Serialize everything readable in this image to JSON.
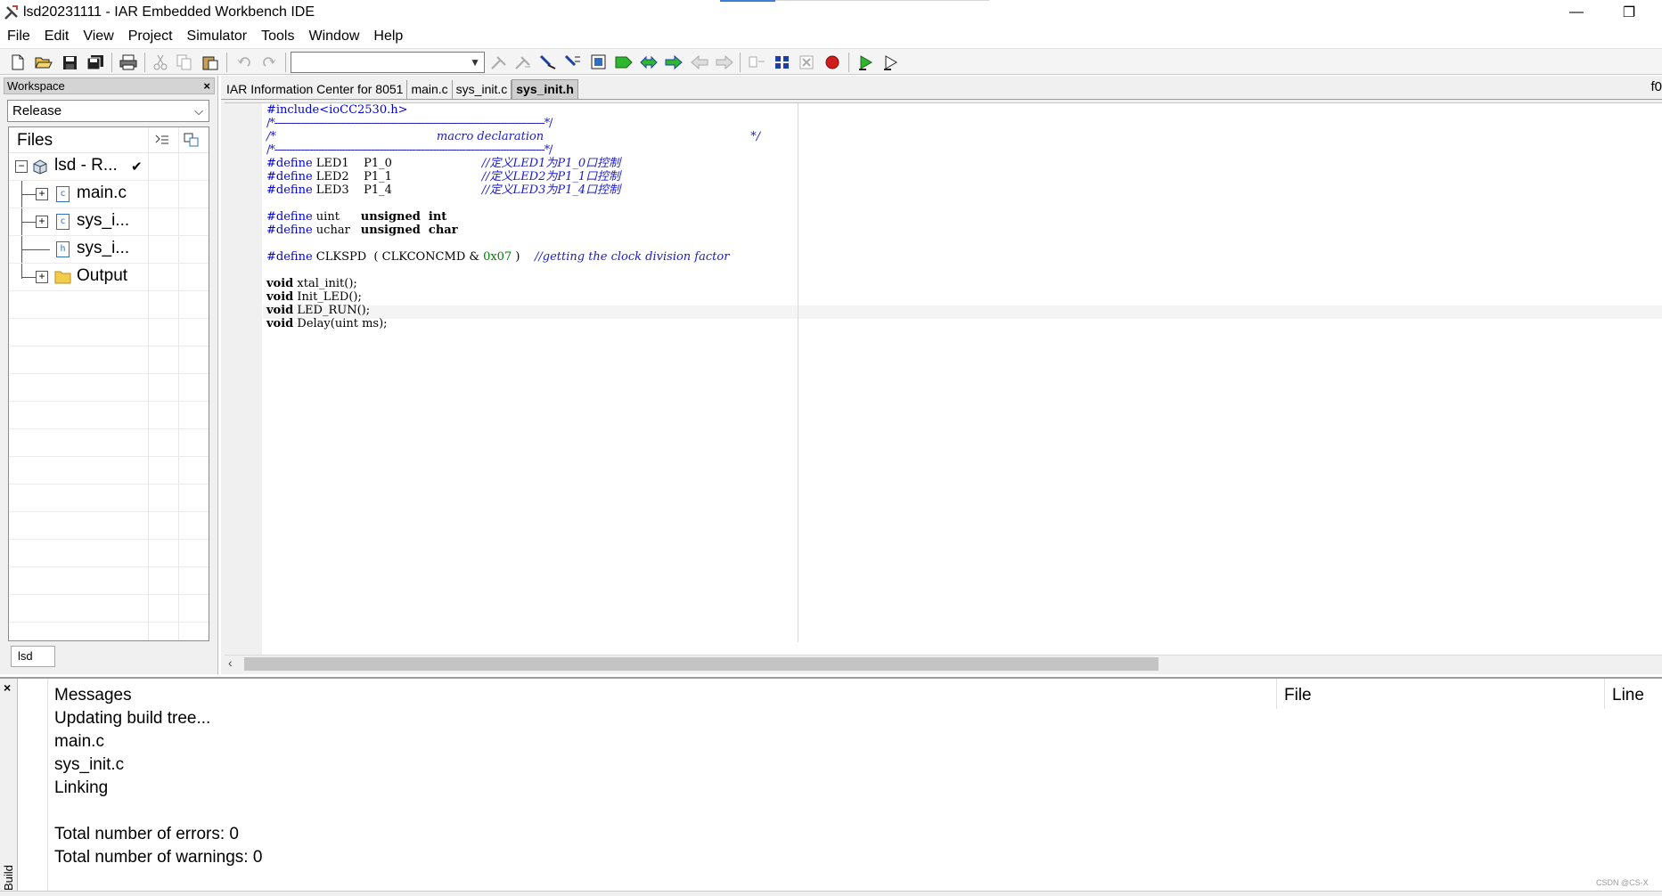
{
  "window": {
    "title": "lsd20231111 - IAR Embedded Workbench IDE",
    "minimize_glyph": "—",
    "restore_glyph": "❐"
  },
  "menu": [
    "File",
    "Edit",
    "View",
    "Project",
    "Simulator",
    "Tools",
    "Window",
    "Help"
  ],
  "toolbar": {
    "combo_value": "",
    "icons": [
      "new-file-icon",
      "open-icon",
      "save-icon",
      "save-all-icon",
      "print-icon",
      "cut-icon",
      "copy-icon",
      "paste-icon",
      "undo-icon",
      "redo-icon",
      "find-icon",
      "replace-icon",
      "goto-icon",
      "bookmark-icon",
      "next-bookmark-icon",
      "prev-bookmark-icon",
      "forward-icon",
      "back-icon",
      "compile-icon",
      "make-icon",
      "stop-build-icon",
      "breakpoint-icon",
      "download-debug-icon",
      "debug-without-download-icon"
    ]
  },
  "workspace": {
    "header": "Workspace",
    "close_glyph": "×",
    "configuration": "Release",
    "files_header": "Files",
    "tree": {
      "project": "lsd - R...",
      "project_check": "✔",
      "items": [
        {
          "label": "main.c"
        },
        {
          "label": "sys_i..."
        },
        {
          "label": "sys_i..."
        },
        {
          "label": "Output"
        }
      ]
    },
    "bottom_tab": "lsd"
  },
  "editor": {
    "tabs": [
      "IAR Information Center for 8051",
      "main.c",
      "sys_init.c",
      "sys_init.h"
    ],
    "active_tab": "sys_init.h",
    "right_label": "f0",
    "code": {
      "include": "#include<ioCC2530.h>",
      "sep1": "/*--------------------------------------------------------------------------------------------*/",
      "macro_prefix": "/*",
      "macro_title": "macro declaration",
      "macro_suffix": "*/",
      "sep2": "/*--------------------------------------------------------------------------------------------*/",
      "led1_name": "LED1    P1_0",
      "led1_comment": "//定义LED1为P1_0口控制",
      "led2_name": "LED2    P1_1",
      "led2_comment": "//定义LED2为P1_1口控制",
      "led3_name": "LED3    P1_4",
      "led3_comment": "//定义LED3为P1_4口控制",
      "uint_name": "uint",
      "uint_type": "unsigned  int",
      "uchar_name": "uchar",
      "uchar_type": "unsigned  char",
      "clkspd_name": "CLKSPD  ( CLKCONCMD & ",
      "clkspd_num": "0x07",
      "clkspd_close": " )",
      "clkspd_comment": "//getting the clock division factor",
      "define_kw": "#define",
      "void_kw": "void",
      "fn1": "xtal_init();",
      "fn2": "Init_LED();",
      "fn3": "LED_RUN();",
      "fn4": "Delay(uint ms);"
    },
    "scroll_left_glyph": "‹"
  },
  "build": {
    "close_glyph": "×",
    "side_label": "Build",
    "headers": {
      "messages": "Messages",
      "file": "File",
      "line": "Line"
    },
    "messages": [
      "Updating build tree...",
      "main.c",
      "sys_init.c",
      "Linking",
      "",
      "Total number of errors: 0",
      "Total number of warnings: 0"
    ]
  },
  "watermark": "CSDN @CS-X"
}
